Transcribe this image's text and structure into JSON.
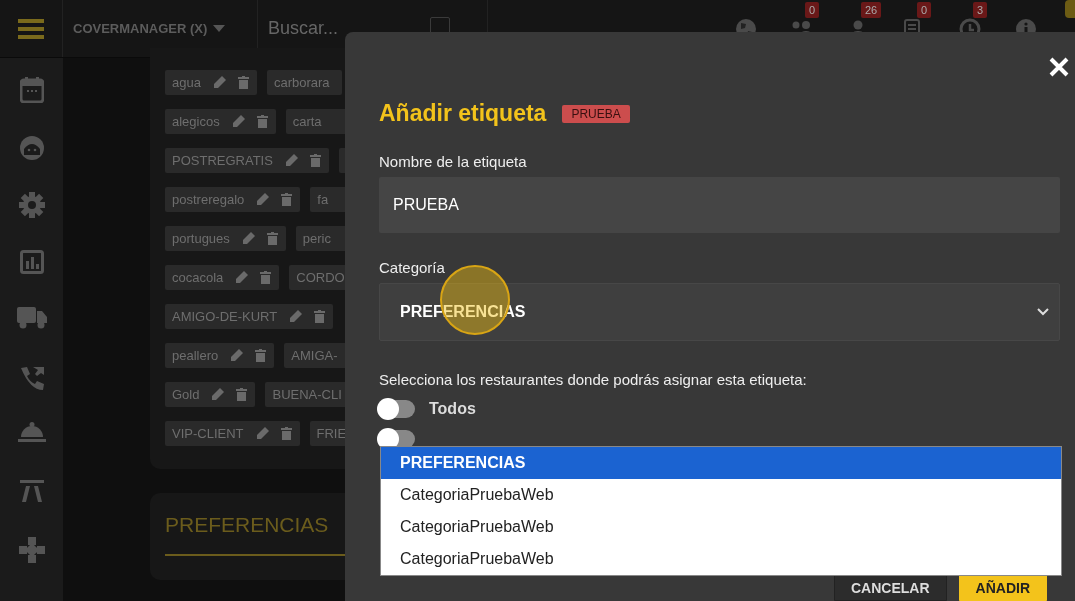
{
  "topbar": {
    "brand": "COVERMANAGER (X)",
    "search": {
      "placeholder": "Buscar..."
    },
    "checkbox": {
      "checked": false
    },
    "icons": [
      {
        "kind": "globe"
      },
      {
        "kind": "group",
        "badge": "0"
      },
      {
        "kind": "person",
        "badge": "26"
      },
      {
        "kind": "list",
        "badge": "0"
      },
      {
        "kind": "clock",
        "badge": "3"
      },
      {
        "kind": "info"
      }
    ]
  },
  "sidebar": {
    "items": [
      {
        "kind": "calendar"
      },
      {
        "kind": "face"
      },
      {
        "kind": "gear"
      },
      {
        "kind": "chart"
      },
      {
        "kind": "truck"
      },
      {
        "kind": "phone"
      },
      {
        "kind": "bell"
      },
      {
        "kind": "table"
      },
      {
        "kind": "puzzle"
      }
    ]
  },
  "tags": {
    "rows": [
      {
        "left": "agua",
        "right": "carborara"
      },
      {
        "left": "alegicos",
        "right": "carta"
      },
      {
        "left": "POSTREGRATIS",
        "right": ""
      },
      {
        "left": "postreregalo",
        "right": "fa"
      },
      {
        "left": "portugues",
        "right": "peric"
      },
      {
        "left": "cocacola",
        "right": "CORDO"
      },
      {
        "left": "AMIGO-DE-KURT"
      },
      {
        "left": "peallero",
        "right": "AMIGA-"
      },
      {
        "left": "Gold",
        "right": "BUENA-CLI"
      },
      {
        "left": "VIP-CLIENT",
        "right": "FRIE"
      }
    ]
  },
  "section_title": "PREFERENCIAS",
  "modal": {
    "title": "Añadir etiqueta",
    "badge": "PRUEBA",
    "name_label": "Nombre de la etiqueta",
    "name_value": "PRUEBA",
    "category_label": "Categoría",
    "category_value": "PREFERENCIAS",
    "restaurants_label": "Selecciona los restaurantes donde podrás asignar esta etiqueta:",
    "toggles": [
      {
        "label": "Todos",
        "on": false
      },
      {
        "on": false
      }
    ],
    "dropdown": [
      {
        "label": "PREFERENCIAS",
        "selected": true
      },
      {
        "label": "CategoriaPruebaWeb",
        "selected": false
      },
      {
        "label": "CategoriaPruebaWeb",
        "selected": false
      },
      {
        "label": "CategoriaPruebaWeb",
        "selected": false
      }
    ],
    "buttons": [
      {
        "label": "CANCELAR",
        "kind": "secondary"
      },
      {
        "label": "AÑADIR",
        "kind": "primary"
      }
    ]
  }
}
